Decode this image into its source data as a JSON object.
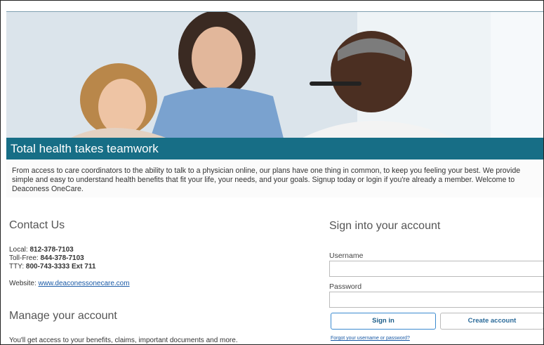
{
  "hero": {
    "banner_title": "Total health takes teamwork",
    "intro_text": "From access to care coordinators to the ability to talk to a physician online, our plans have one thing in common, to keep you feeling your best. We provide simple and easy to understand health benefits that fit your life, your needs, and your goals. Signup today or login if you're already a member. Welcome to Deaconess OneCare."
  },
  "contact": {
    "title": "Contact Us",
    "local_label": "Local: ",
    "local_value": "812-378-7103",
    "tollfree_label": "Toll-Free: ",
    "tollfree_value": "844-378-7103",
    "tty_label": "TTY: ",
    "tty_value": "800-743-3333 Ext 711",
    "website_label": "Website: ",
    "website_link": "www.deaconessonecare.com"
  },
  "manage": {
    "title": "Manage your account",
    "text": "You'll get access to your benefits, claims, important documents and more."
  },
  "signin": {
    "title": "Sign into your account",
    "username_label": "Username",
    "username_value": "",
    "password_label": "Password",
    "password_value": "",
    "signin_button": "Sign in",
    "create_button": "Create account",
    "forgot_link": "Forgot your username or password?"
  },
  "colors": {
    "banner": "#176e86",
    "link": "#1a5aa6",
    "button_border_active": "#3b8bd0"
  }
}
